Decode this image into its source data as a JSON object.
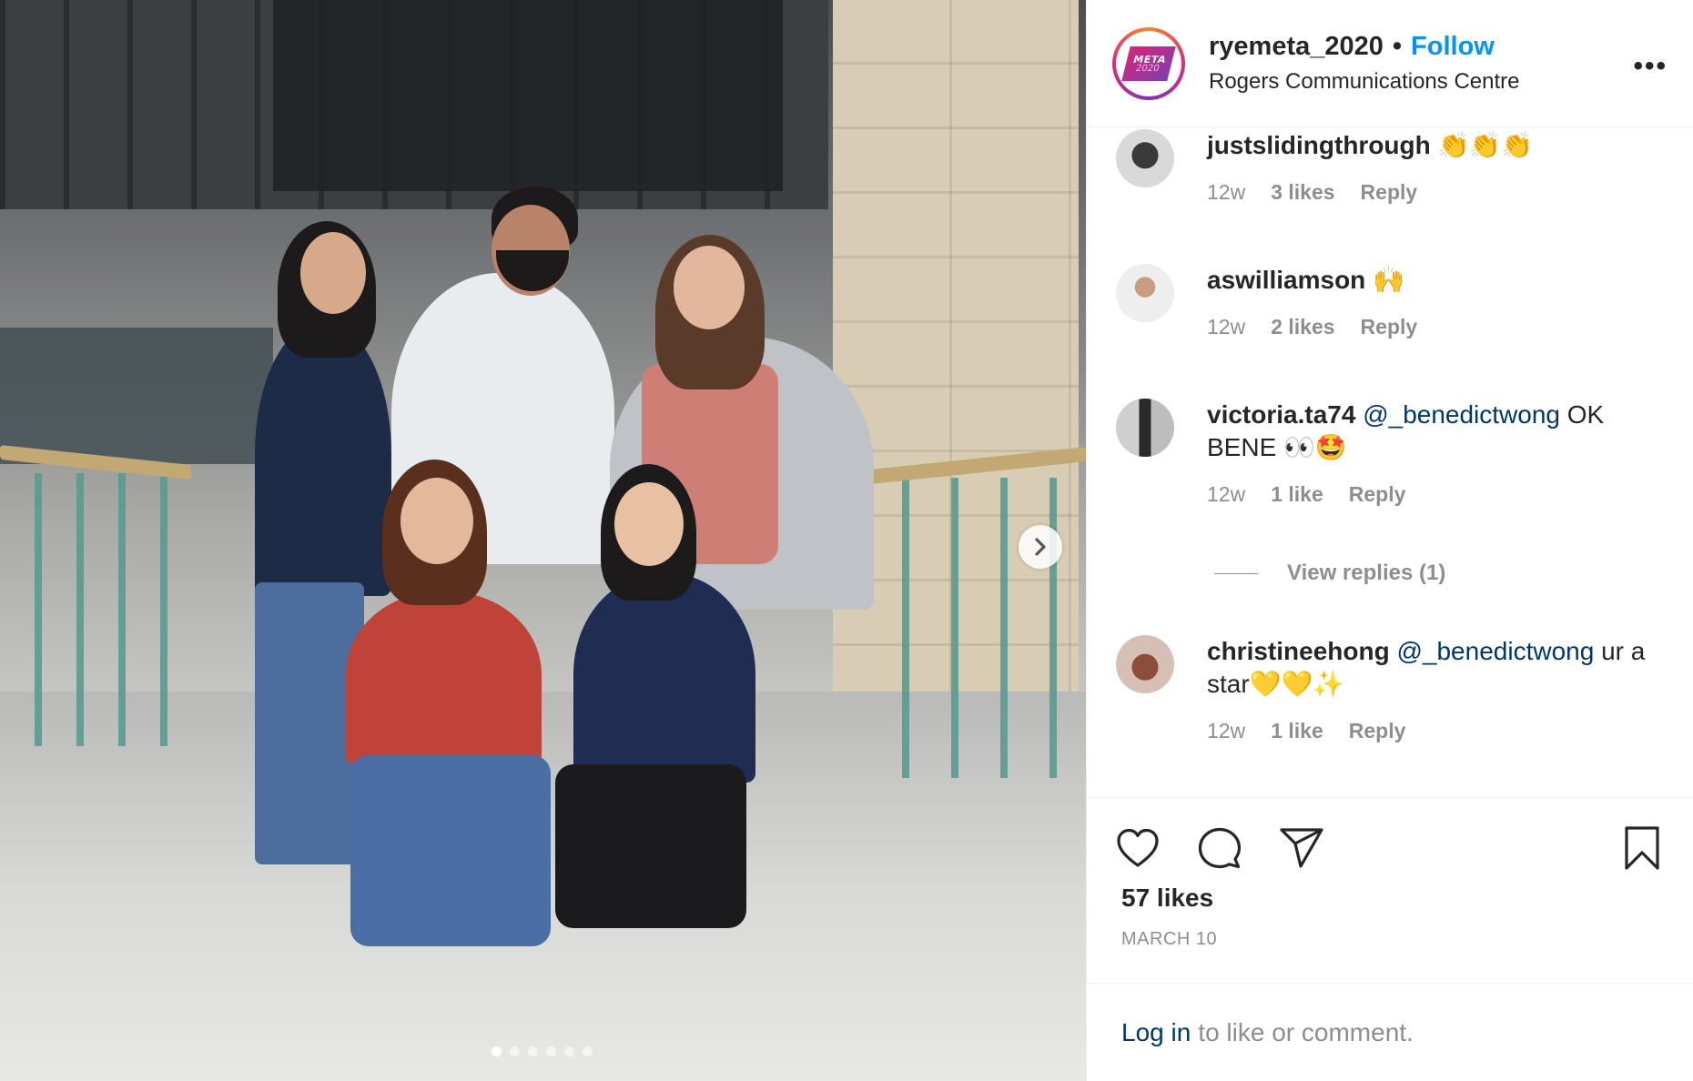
{
  "post": {
    "username": "ryemeta_2020",
    "separator": "•",
    "follow_label": "Follow",
    "location": "Rogers Communications Centre",
    "more_label": "•••",
    "avatar_logo": {
      "line1": "META",
      "line2": "2020"
    },
    "carousel": {
      "total_slides": 6,
      "active_slide": 1
    }
  },
  "comments": [
    {
      "user": "justslidingthrough",
      "text": "👏👏👏",
      "mention": "",
      "text_after": "",
      "time": "12w",
      "likes": "3 likes",
      "reply": "Reply"
    },
    {
      "user": "aswilliamson",
      "text": "🙌",
      "mention": "",
      "text_after": "",
      "time": "12w",
      "likes": "2 likes",
      "reply": "Reply"
    },
    {
      "user": "victoria.ta74",
      "text": "",
      "mention": "@_benedictwong",
      "text_after": "OK BENE 👀🤩",
      "time": "12w",
      "likes": "1 like",
      "reply": "Reply"
    },
    {
      "user": "christineehong",
      "text": "",
      "mention": "@_benedictwong",
      "text_after": "ur a star💛💛✨",
      "time": "12w",
      "likes": "1 like",
      "reply": "Reply"
    }
  ],
  "view_replies": "View replies (1)",
  "footer": {
    "likes": "57 likes",
    "date": "MARCH 10",
    "login_link": "Log in",
    "login_text": "to like or comment."
  },
  "colors": {
    "accent": "#0095f6",
    "mention": "#00376b",
    "muted": "#8e8e8e"
  }
}
